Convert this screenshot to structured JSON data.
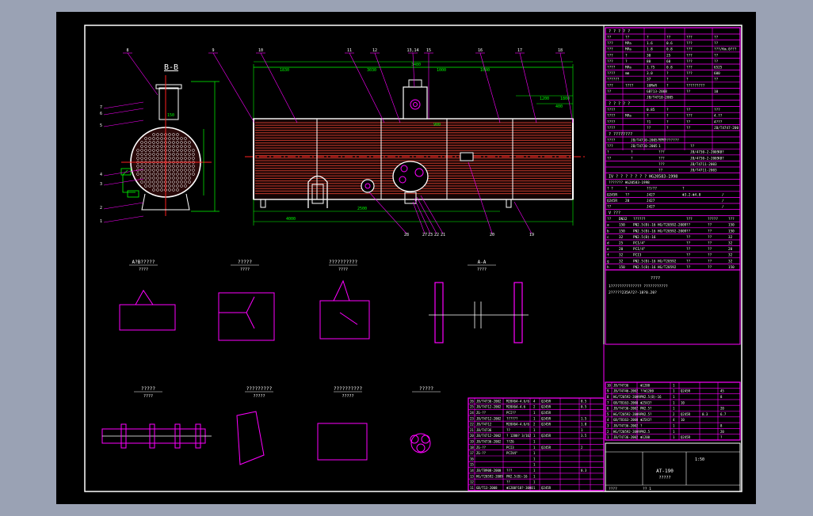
{
  "colors": {
    "frame": "#ffffff",
    "table": "#ff00ff",
    "dim": "#00ff00",
    "text": "#ffffff",
    "tubes": "#c0392b",
    "center": "#ff2020",
    "leader": "#ff00ff"
  },
  "view_bb": {
    "title": "B-B",
    "dim_labels": [
      "150"
    ],
    "part_tags": [
      "7",
      "6",
      "5",
      "4",
      "3",
      "2",
      "1"
    ]
  },
  "elevation": {
    "top_dims": [
      "1830",
      "3030",
      "1000",
      "3480",
      "1000"
    ],
    "bottom_dims": [
      "2500",
      "4000"
    ],
    "callouts_top": [
      "8",
      "9",
      "10",
      "11",
      "12",
      "13,14",
      "15",
      "16",
      "17",
      "18"
    ],
    "callouts_bottom": [
      "28",
      "27",
      "23",
      "22",
      "21",
      "20",
      "19"
    ],
    "misc_labels": [
      "1200",
      "1800",
      "400",
      "900"
    ]
  },
  "details": [
    {
      "id": "det1",
      "title": "A?B?????",
      "sub": "????"
    },
    {
      "id": "det2",
      "title": "?????",
      "sub": "????"
    },
    {
      "id": "det3",
      "title": "??????????",
      "sub": "????"
    },
    {
      "id": "det4",
      "title": "A-A",
      "sub": "????"
    },
    {
      "id": "det5",
      "title": "?????",
      "sub": "????"
    },
    {
      "id": "det6",
      "title": "?????????",
      "sub": "?????"
    },
    {
      "id": "det7",
      "title": "??????????",
      "sub": "?????"
    },
    {
      "id": "det8",
      "title": "?????",
      "sub": ""
    }
  ],
  "spec_table": {
    "header": "? ? ? ? ?",
    "rows": [
      [
        "??",
        "??",
        "?",
        "??",
        "???",
        "??"
      ],
      [
        "???",
        "MPa",
        "1.6",
        "0.6",
        "???",
        "??"
      ],
      [
        "???",
        "MPa",
        "1.8",
        "0.8",
        "???",
        "???/Km.0???"
      ],
      [
        "???",
        "?",
        "30",
        "25",
        "???",
        "??"
      ],
      [
        "???",
        "?",
        "80",
        "60",
        "???",
        "??"
      ],
      [
        "????",
        "MPa",
        "1.75",
        "0.8",
        "???",
        "6525"
      ],
      [
        "????",
        "mm",
        "3.0",
        "?",
        "???",
        "600"
      ],
      [
        "??????",
        "",
        "37",
        "?",
        "?",
        "??"
      ],
      [
        "???",
        "????",
        "16MnR",
        "?",
        "?????????",
        ""
      ],
      [
        "??",
        "",
        "GB713-2008",
        "",
        "??",
        "10"
      ],
      [
        "",
        "",
        "JB/T4710-2005",
        "",
        "",
        ""
      ]
    ],
    "section2": "? ? ? ? ?",
    "rows2": [
      [
        "????",
        "",
        "0.85",
        "?",
        "??",
        "???"
      ],
      [
        "????",
        "MPa",
        "?",
        "?",
        "???",
        "4.??"
      ],
      [
        "????",
        "",
        "?1",
        "?",
        "??",
        "4???"
      ],
      [
        "????",
        "",
        "??",
        "?",
        "??",
        "JB/T4747-200"
      ]
    ],
    "section3": "? ????????",
    "rows3": [
      [
        "????",
        "JB/T4730-2005????",
        "??????????"
      ],
      [
        "???",
        "JB/T4730-2005",
        "1",
        "??"
      ],
      [
        "?",
        "?",
        "???",
        "JB/4730-2-2005",
        "AB?"
      ],
      [
        "??",
        "?",
        "???",
        "JB/4730-2-2005",
        "AB?"
      ],
      [
        "",
        "",
        "???",
        "JB/T4711-2003"
      ],
      [
        "",
        "",
        "??",
        "JB/T4711-2003"
      ]
    ],
    "std_line": "IV ? ? ?          ? ? ? ?   HG20583-1998",
    "std_sub": "???????   HG20583-1998",
    "rows4": [
      [
        "? ?",
        "?",
        "??/??",
        "?"
      ],
      [
        "Q245R",
        "??",
        "J427",
        "Φ3.2-Φ4.0",
        "/"
      ],
      [
        "Q245R",
        "20",
        "J427",
        "",
        "/"
      ],
      [
        "??",
        "",
        "J427",
        "",
        "/"
      ]
    ],
    "section5": "V ???",
    "nozzle_header": [
      "??",
      "DN32",
      "??????",
      "???",
      "?????",
      "???"
    ],
    "nozzles": [
      [
        "a",
        "150",
        "PN2.5(B)-16 HG/T20592-2009",
        "??",
        "??",
        "150"
      ],
      [
        "b",
        "150",
        "PN2.5(B)-16 HG/T20592-2009",
        "??",
        "??",
        "150"
      ],
      [
        "c",
        "32",
        "PN2.5(B)-16",
        "??",
        "??",
        "32"
      ],
      [
        "d",
        "25",
        "PCI/4\"",
        "??",
        "??",
        "32"
      ],
      [
        "e",
        "20",
        "PCI/4\"",
        "??",
        "??",
        "20"
      ],
      [
        "f",
        "32",
        "PCI3",
        "??",
        "??",
        "32"
      ],
      [
        "g",
        "32",
        "PN2.5(B)-16 HG/T20592",
        "??",
        "??",
        "32"
      ],
      [
        "h",
        "150",
        "PN2.5(B)-16 HG/T20592",
        "??",
        "??",
        "150"
      ]
    ],
    "notes_title": "????",
    "notes": [
      "1?????????????? ???????????",
      "2?????235A?2?-18?0.20?"
    ]
  },
  "bom": {
    "rows": [
      [
        "26",
        "JB/T4736-2002",
        "M20X64-4.6/6",
        "4",
        "Q245R",
        "",
        "0.5",
        ""
      ],
      [
        "25",
        "JB/T4712-2002",
        "M20X64-4.6",
        "2",
        "Q245R",
        "",
        "0.5",
        ""
      ],
      [
        "24",
        "ZG-??",
        "PCI??",
        "1",
        "Q245R",
        "",
        "",
        ""
      ],
      [
        "23",
        "JB/T4712-2002",
        "??????",
        "1",
        "Q245R",
        "",
        "1.5",
        ""
      ],
      [
        "22",
        "JB/T4712",
        "M20X64-4.6/6",
        "2",
        "Q245R",
        "",
        "1.0",
        ""
      ],
      [
        "21",
        "JB/T4736",
        "??",
        "1",
        "",
        "",
        "1",
        ""
      ],
      [
        "20",
        "JB/T4712-2002",
        "? 1200? 3/162",
        "1",
        "Q245R",
        "",
        "3.5",
        ""
      ],
      [
        "19",
        "JB/T4736-2002",
        "??Z6",
        "1",
        "",
        "",
        "",
        ""
      ],
      [
        "18",
        "ZG-??",
        "PCI3",
        "1",
        "Q245R",
        "",
        "2",
        ""
      ],
      [
        "17",
        "ZG-??",
        "PCIV4\"",
        "1",
        "",
        "",
        "",
        ""
      ],
      [
        "16",
        "",
        "",
        "1",
        "",
        "",
        "",
        ""
      ],
      [
        "15",
        "",
        "",
        "1",
        "",
        "",
        "",
        ""
      ],
      [
        "14",
        "JB/T8908-2000",
        "???",
        "1",
        "",
        "",
        "0.3",
        ""
      ],
      [
        "13",
        "HG/T20592-2009",
        "PN2.5(B)-16",
        "1",
        "",
        "",
        "",
        ""
      ],
      [
        "12",
        "",
        "??",
        "1",
        "",
        "",
        "",
        ""
      ],
      [
        "11",
        "GB/T13-2008",
        "Φ1200?10?-3000",
        "1",
        "Q245R",
        "",
        "",
        ""
      ]
    ],
    "rows_right": [
      [
        "10",
        "JB/T4736",
        "Φ1200",
        "1",
        "",
        "",
        ""
      ],
      [
        "9",
        "JB/T4746-2002",
        "??Φ1200",
        "1",
        "Q245R",
        "",
        "45"
      ],
      [
        "8",
        "HG/T20592-2009",
        "PN2.5(B)-16",
        "1",
        "",
        "",
        "8"
      ],
      [
        "7",
        "GB/T8163-2008",
        "Φ25X3?",
        "1",
        "10",
        "",
        ""
      ],
      [
        "6",
        "JB/T4736-2002",
        "PN2.5?",
        "1",
        "",
        "",
        "20"
      ],
      [
        "5",
        "HG/T20592-2009",
        "PN2.5?",
        "2",
        "Q245R",
        "0.3",
        "6.7"
      ],
      [
        "4",
        "GB/T8163-2008",
        "Φ25X3?",
        "4",
        "10",
        "",
        ""
      ],
      [
        "3",
        "JB/T4736-2002",
        "?",
        "1",
        "",
        "",
        "8"
      ],
      [
        "2",
        "HG/T20592-2009",
        "PN2.5",
        "1",
        "",
        "",
        "20"
      ],
      [
        "1",
        "JB/T4736-2002",
        "Φ1200",
        "1",
        "Q245R",
        "",
        "?"
      ]
    ]
  },
  "title_block": {
    "drawing_no": "AT-190",
    "name": "?????",
    "scale": "1:50",
    "bottom_left": "????",
    "bottom_mid": "?? 1"
  }
}
